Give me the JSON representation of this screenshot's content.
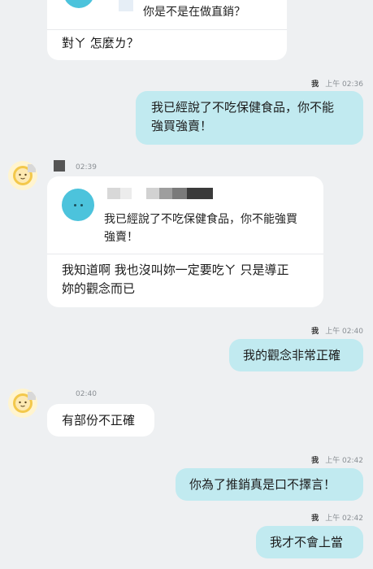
{
  "messages": {
    "m1": {
      "quote_text": "你是不是在做直銷？",
      "text": "對ㄚ 怎麼ㄌ？"
    },
    "m2": {
      "sender": "我",
      "time": "上午 02:36",
      "text_line1": "我已經說了不吃保健食品，你不能",
      "text_line2": "強買強賣！"
    },
    "m3": {
      "time": "02:39",
      "quote_line1": "我已經說了不吃保健食品，你不能強買",
      "quote_line2": "強賣！",
      "text_line1": "我知道啊 我也沒叫妳一定要吃ㄚ 只是導正",
      "text_line2": "妳的觀念而已"
    },
    "m4": {
      "sender": "我",
      "time": "上午 02:40",
      "text": "我的觀念非常正確"
    },
    "m5": {
      "time": "02:40",
      "text": "有部份不正確"
    },
    "m6": {
      "sender": "我",
      "time": "上午 02:42",
      "text": "你為了推銷真是口不擇言！"
    },
    "m7": {
      "sender": "我",
      "time": "上午 02:42",
      "text": "我才不會上當"
    }
  },
  "colors": {
    "background": "#eef0f2",
    "incoming_bubble": "#ffffff",
    "outgoing_bubble": "#c1eaf0",
    "quote_avatar": "#4cc3dc",
    "sun_avatar": "#f3c84b"
  },
  "icons": [
    "sun-avatar-icon",
    "cloud-avatar-icon"
  ]
}
